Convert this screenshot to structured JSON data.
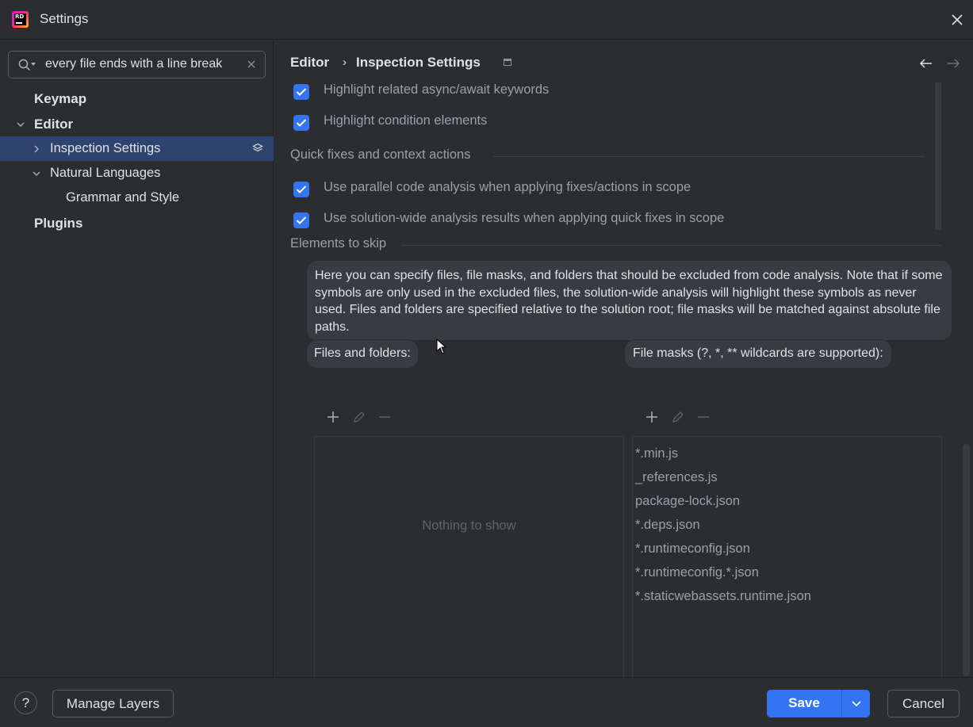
{
  "window": {
    "title": "Settings",
    "logo_text": "RD"
  },
  "sidebar": {
    "search_query": "every file ends with a line break",
    "items": [
      {
        "label": "Keymap"
      },
      {
        "label": "Editor"
      },
      {
        "label": "Inspection Settings"
      },
      {
        "label": "Natural Languages"
      },
      {
        "label": "Grammar and Style"
      },
      {
        "label": "Plugins"
      }
    ]
  },
  "breadcrumb": {
    "parent": "Editor",
    "separator": "›",
    "current": "Inspection Settings"
  },
  "options": {
    "opt1": {
      "label": "Highlight related async/await keywords",
      "checked": true
    },
    "opt2": {
      "label": "Highlight condition elements",
      "checked": true
    },
    "section_quick_fixes": "Quick fixes and context actions",
    "opt3": {
      "label": "Use parallel code analysis when applying fixes/actions in scope",
      "checked": true
    },
    "opt4": {
      "label": "Use solution-wide analysis results when applying quick fixes in scope",
      "checked": true
    },
    "section_skip": "Elements to skip"
  },
  "skip": {
    "description": "Here you can specify files, file masks, and folders that should be excluded from code analysis. Note that if some symbols are only used in the excluded files, the solution-wide analysis will highlight these symbols as never used. Files and folders are specified relative to the solution root; file masks will be matched against absolute file paths.",
    "files_label": "Files and folders:",
    "masks_label": "File masks (?, *, ** wildcards are supported):",
    "files_empty": "Nothing to show",
    "masks": [
      "*.min.js",
      "_references.js",
      "package-lock.json",
      "*.deps.json",
      "*.runtimeconfig.json",
      "*.runtimeconfig.*.json",
      "*.staticwebassets.runtime.json"
    ]
  },
  "footer": {
    "help": "?",
    "manage_layers": "Manage Layers",
    "save": "Save",
    "cancel": "Cancel"
  },
  "colors": {
    "accent": "#3574f0",
    "selection": "#2e436e",
    "background": "#2b2d30"
  }
}
